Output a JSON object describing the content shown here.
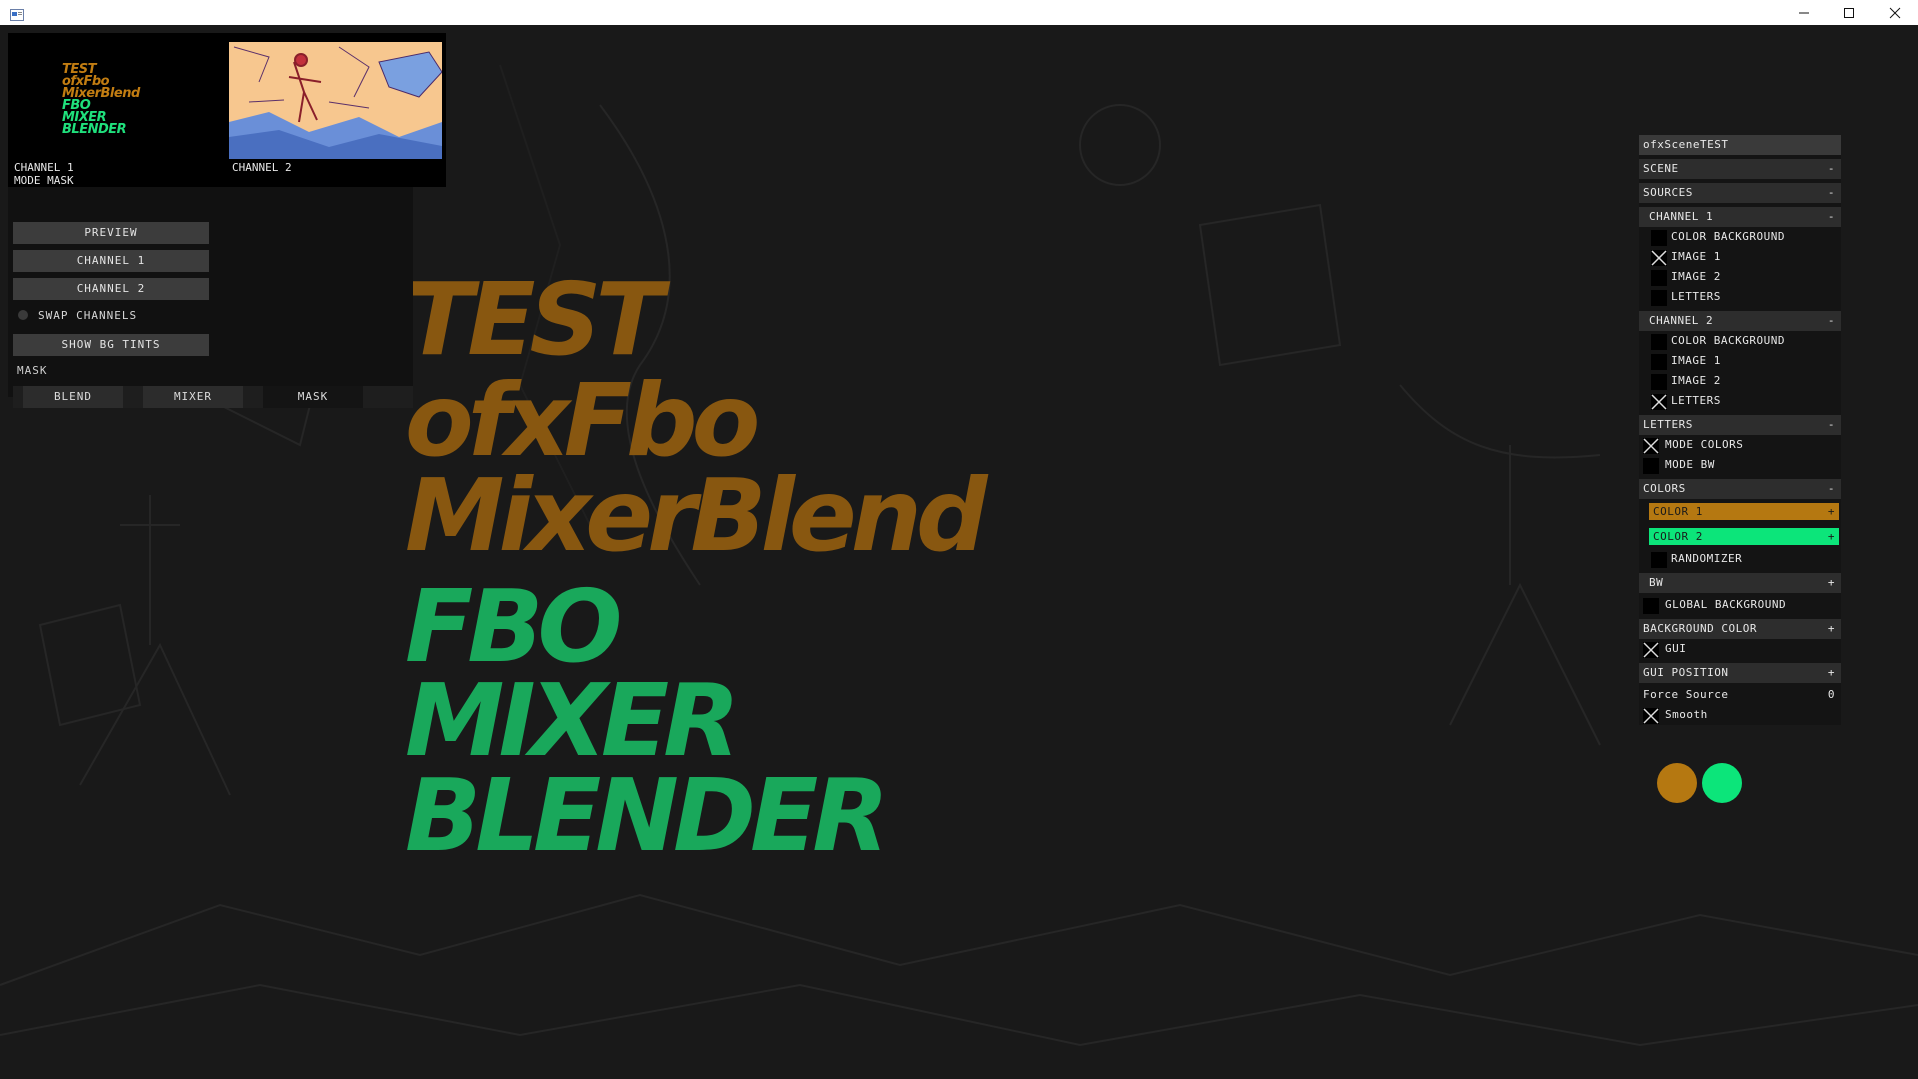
{
  "window": {
    "minimize_icon": "minimize-icon",
    "maximize_icon": "maximize-icon",
    "close_icon": "close-icon"
  },
  "main_text": {
    "lines": [
      "TEST",
      "ofxFbo",
      "MixerBlend",
      "FBO",
      "MIXER",
      "BLENDER"
    ]
  },
  "previews": {
    "channel1_caption": "CHANNEL 1",
    "channel1_mode": "MODE MASK",
    "channel2_caption": "CHANNEL 2",
    "thumb_lines": [
      "TEST",
      "ofxFbo",
      "MixerBlend",
      "FBO",
      "MIXER",
      "BLENDER"
    ]
  },
  "left_panel": {
    "preview": "PREVIEW",
    "channel1": "CHANNEL 1",
    "channel2": "CHANNEL 2",
    "swap_channels": "SWAP CHANNELS",
    "show_bg_tints": "SHOW BG TINTS",
    "mask_label": "MASK",
    "tabs": [
      "BLEND",
      "MIXER",
      "MASK"
    ]
  },
  "gui": {
    "title": "ofxSceneTEST",
    "scene": "SCENE",
    "sources": "SOURCES",
    "channel1": "CHANNEL 1",
    "ch1_items": [
      "COLOR BACKGROUND",
      "IMAGE 1",
      "IMAGE 2",
      "LETTERS"
    ],
    "ch1_checked": [
      false,
      true,
      false,
      false
    ],
    "channel2": "CHANNEL 2",
    "ch2_items": [
      "COLOR BACKGROUND",
      "IMAGE 1",
      "IMAGE 2",
      "LETTERS"
    ],
    "ch2_checked": [
      false,
      false,
      false,
      true
    ],
    "letters": "LETTERS",
    "mode_colors": "MODE COLORS",
    "mode_bw": "MODE BW",
    "colors": "COLORS",
    "color1": "COLOR 1",
    "color2": "COLOR 2",
    "randomizer": "RANDOMIZER",
    "bw": "BW",
    "global_background": "GLOBAL BACKGROUND",
    "background_color": "BACKGROUND COLOR",
    "gui_label": "GUI",
    "gui_position": "GUI POSITION",
    "force_source": "Force Source",
    "force_source_value": "0",
    "smooth": "Smooth",
    "minus": "-",
    "plus": "+"
  },
  "colors": {
    "color1": "#b57811",
    "color2": "#0ce57a",
    "orange_letters": "#885710",
    "green_letters": "#19a85b"
  }
}
